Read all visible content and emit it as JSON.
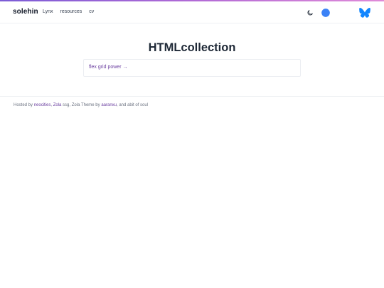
{
  "header": {
    "brand": "solehin",
    "nav": [
      {
        "label": "Lynx"
      },
      {
        "label": "resources"
      },
      {
        "label": "cv"
      }
    ],
    "icons": {
      "theme_toggle": "moon-icon",
      "chat": "chat-bubble-icon",
      "social": "butterfly-icon"
    },
    "colors": {
      "accent": "#3b82f6",
      "butterfly": "#1185fe",
      "gradient_start": "#7b5cd6",
      "gradient_end": "#e08bd8"
    }
  },
  "main": {
    "title": "HTMLcollection",
    "link_label": "flex grid power →",
    "link_color": "#6b3fa0"
  },
  "footer": {
    "prefix": "Hosted by ",
    "host_link": "neocities",
    "sep1": ", ",
    "ssg_link": "Zola",
    "ssg_text": " ssg, Zola Theme by ",
    "theme_author_link": "aaranxu",
    "suffix": ", and abit of soul"
  }
}
